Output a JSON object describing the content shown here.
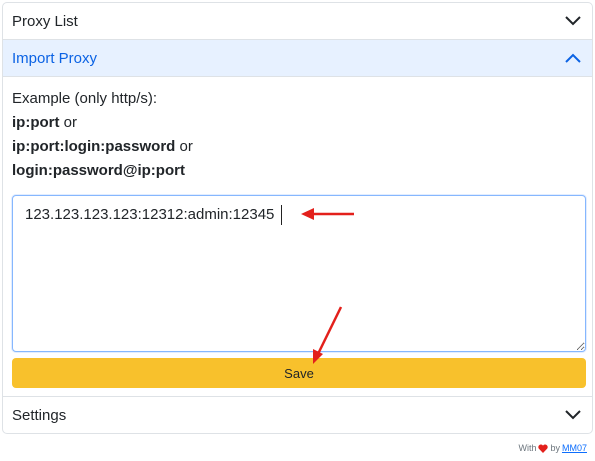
{
  "sections": {
    "proxy_list": {
      "title": "Proxy List"
    },
    "import_proxy": {
      "title": "Import Proxy",
      "example_intro": "Example (only http/s):",
      "format1": "ip:port",
      "format2": "ip:port:login:password",
      "format3": "login:password@ip:port",
      "or_word": "or",
      "input_value": "123.123.123.123:12312:admin:12345",
      "save_label": "Save"
    },
    "settings": {
      "title": "Settings"
    }
  },
  "footer": {
    "prefix": "With",
    "by": "by",
    "author": "MM07"
  },
  "icons": {
    "expand": "chevron-down-icon",
    "collapse": "chevron-up-icon",
    "heart": "heart-icon"
  },
  "colors": {
    "save_button": "#f8c12c",
    "active_header_bg": "#e7f1ff",
    "active_header_text": "#0c63e4",
    "annotation": "#e3201b"
  }
}
